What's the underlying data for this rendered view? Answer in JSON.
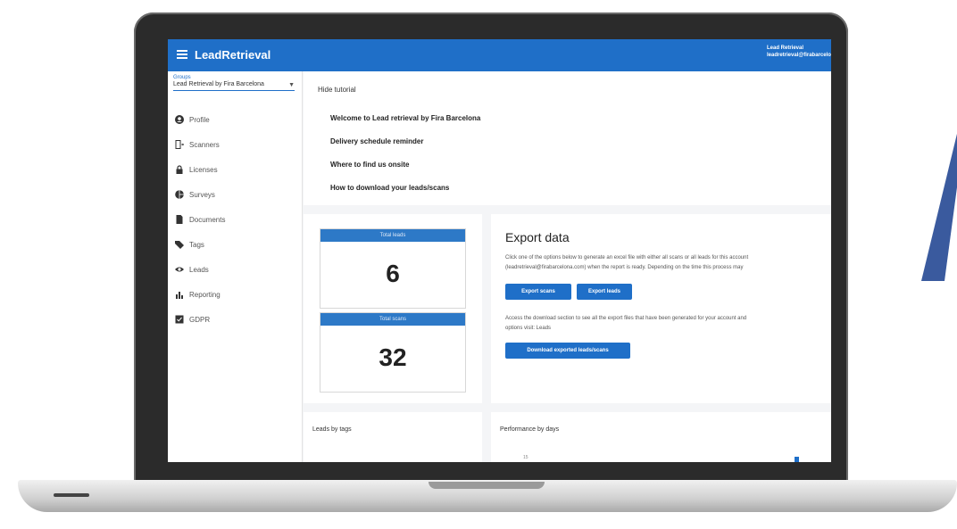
{
  "app": {
    "title": "LeadRetrieval",
    "user_name": "Lead Retrieval",
    "user_email": "leadretrieval@firabarcelona.com"
  },
  "sidebar": {
    "group_label": "Groups",
    "group_value": "Lead Retrieval by Fira Barcelona",
    "items": [
      {
        "label": "Profile",
        "icon": "account-circle-icon"
      },
      {
        "label": "Scanners",
        "icon": "scanner-icon"
      },
      {
        "label": "Licenses",
        "icon": "lock-icon"
      },
      {
        "label": "Surveys",
        "icon": "pie-chart-icon"
      },
      {
        "label": "Documents",
        "icon": "document-icon"
      },
      {
        "label": "Tags",
        "icon": "tag-icon"
      },
      {
        "label": "Leads",
        "icon": "eye-icon"
      },
      {
        "label": "Reporting",
        "icon": "bar-chart-icon"
      },
      {
        "label": "GDPR",
        "icon": "checkbox-icon"
      }
    ]
  },
  "tutorial": {
    "hide_label": "Hide tutorial",
    "items": [
      "Welcome to Lead retrieval by Fira Barcelona",
      "Delivery schedule reminder",
      "Where to find us onsite",
      "How to download your leads/scans"
    ]
  },
  "stats": {
    "total_leads_label": "Total leads",
    "total_leads_value": "6",
    "total_scans_label": "Total scans",
    "total_scans_value": "32"
  },
  "export": {
    "title": "Export data",
    "line1": "Click one of the options below to generate an excel file with either all scans or all leads for this account",
    "line2": "(leadretrieval@firabarcelona.com) when the report is ready. Depending on the time this process may",
    "export_scans_label": "Export scans",
    "export_leads_label": "Export leads",
    "line3": "Access the download section to see all the export files that have been generated for your account and",
    "line4": "options visit: Leads",
    "download_label": "Download exported leads/scans"
  },
  "bottom": {
    "leads_by_tags_title": "Leads by tags",
    "performance_title": "Performance by days",
    "axis_tick": "15"
  },
  "colors": {
    "primary": "#1f6fc8",
    "deco": "#3a5a9e"
  }
}
